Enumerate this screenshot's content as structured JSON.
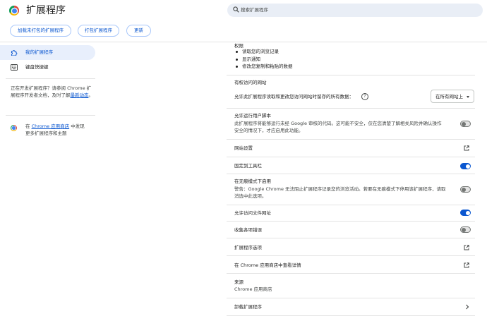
{
  "header": {
    "title": "扩展程序",
    "search_placeholder": "搜索扩展程序",
    "buttons": {
      "load_unpacked": "加载未打包的扩展程序",
      "pack": "打包扩展程序",
      "update": "更新"
    }
  },
  "sidebar": {
    "items": [
      {
        "label": "我的扩展程序",
        "icon": "puzzle-icon",
        "active": true
      },
      {
        "label": "键盘快捷键",
        "icon": "keyboard-icon",
        "active": false
      }
    ],
    "dev_note": {
      "text": "正在开发扩展程序？请参阅 Chrome 扩展程序开发者文档，及时了解",
      "link": "最新动态",
      "end": "。"
    },
    "store_note": {
      "prefix": "在 ",
      "link": "Chrome 应用商店",
      "suffix": " 中发现更多扩展程序和主题"
    }
  },
  "details": {
    "permissions": {
      "title": "权限",
      "items": [
        "读取您的浏览记录",
        "显示通知",
        "修改您复制和粘贴的数据"
      ]
    },
    "site_access": {
      "heading": "有权访问的网站",
      "label": "允许此扩展程序读取和更改您访问网站时留存的所有数据：",
      "selected": "在所有网站上"
    },
    "user_scripts": {
      "title": "允许运行用户脚本",
      "desc_line1": "此扩展程序将能够运行未经 Google 审核的代码。这可能不安全，仅在您清楚了解相关风险并确认操作",
      "desc_line2": "安全的情况下，才应启用此功能。",
      "enabled": false
    },
    "site_settings": "网站设置",
    "pin_toolbar": {
      "label": "固定到工具栏",
      "enabled": true
    },
    "incognito": {
      "title": "在无痕模式下启用",
      "desc_line1": "警告：Google Chrome 无法阻止扩展程序记录您的浏览活动。若要在无痕模式下停用该扩展程序，请取",
      "desc_line2": "消选中此选项。",
      "enabled": false
    },
    "file_urls": {
      "label": "允许访问文件网址",
      "enabled": true
    },
    "collect_errors": {
      "label": "收集各项错误",
      "enabled": false
    },
    "extension_options": "扩展程序选项",
    "view_in_store": "在 Chrome 应用商店中查看详情",
    "source": {
      "title": "来源",
      "value": "Chrome 应用商店"
    },
    "remove": "卸载扩展程序"
  },
  "colors": {
    "accent": "#0b57d0",
    "active_bg": "#e8effc",
    "search_bg": "#e9eef6",
    "divider": "#e3e3e3"
  }
}
